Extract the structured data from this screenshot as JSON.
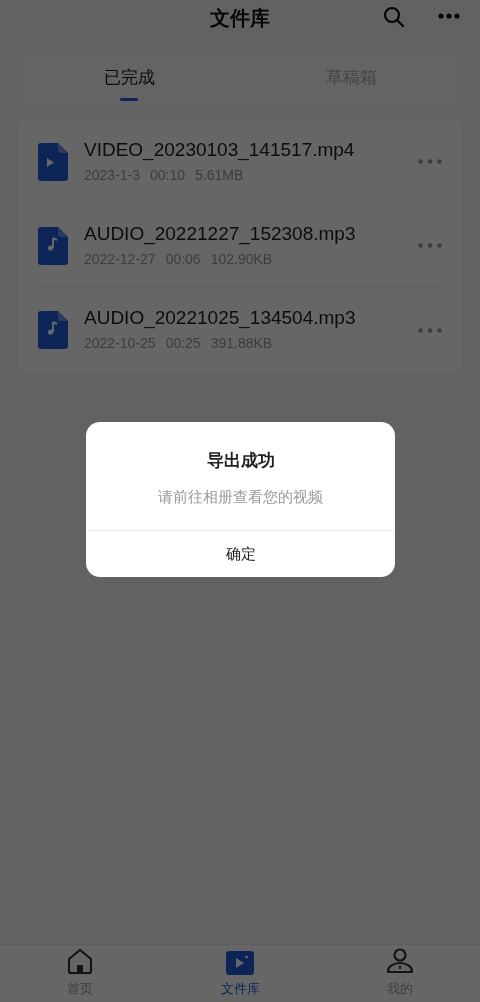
{
  "header": {
    "title": "文件库"
  },
  "tabs": [
    {
      "label": "已完成",
      "selected": true
    },
    {
      "label": "草稿箱",
      "selected": false
    }
  ],
  "files": [
    {
      "kind": "video",
      "name": "VIDEO_20230103_141517.mp4",
      "date": "2023-1-3",
      "duration": "00:10",
      "size": "5.61MB"
    },
    {
      "kind": "audio",
      "name": "AUDIO_20221227_152308.mp3",
      "date": "2022-12-27",
      "duration": "00:06",
      "size": "102.90KB"
    },
    {
      "kind": "audio",
      "name": "AUDIO_20221025_134504.mp3",
      "date": "2022-10-25",
      "duration": "00:25",
      "size": "391.88KB"
    }
  ],
  "dialog": {
    "title": "导出成功",
    "message": "请前往相册查看您的视频",
    "button": "确定"
  },
  "bottom_nav": [
    {
      "kind": "home",
      "label": "首页",
      "selected": false
    },
    {
      "kind": "library",
      "label": "文件库",
      "selected": true
    },
    {
      "kind": "profile",
      "label": "我的",
      "selected": false
    }
  ]
}
